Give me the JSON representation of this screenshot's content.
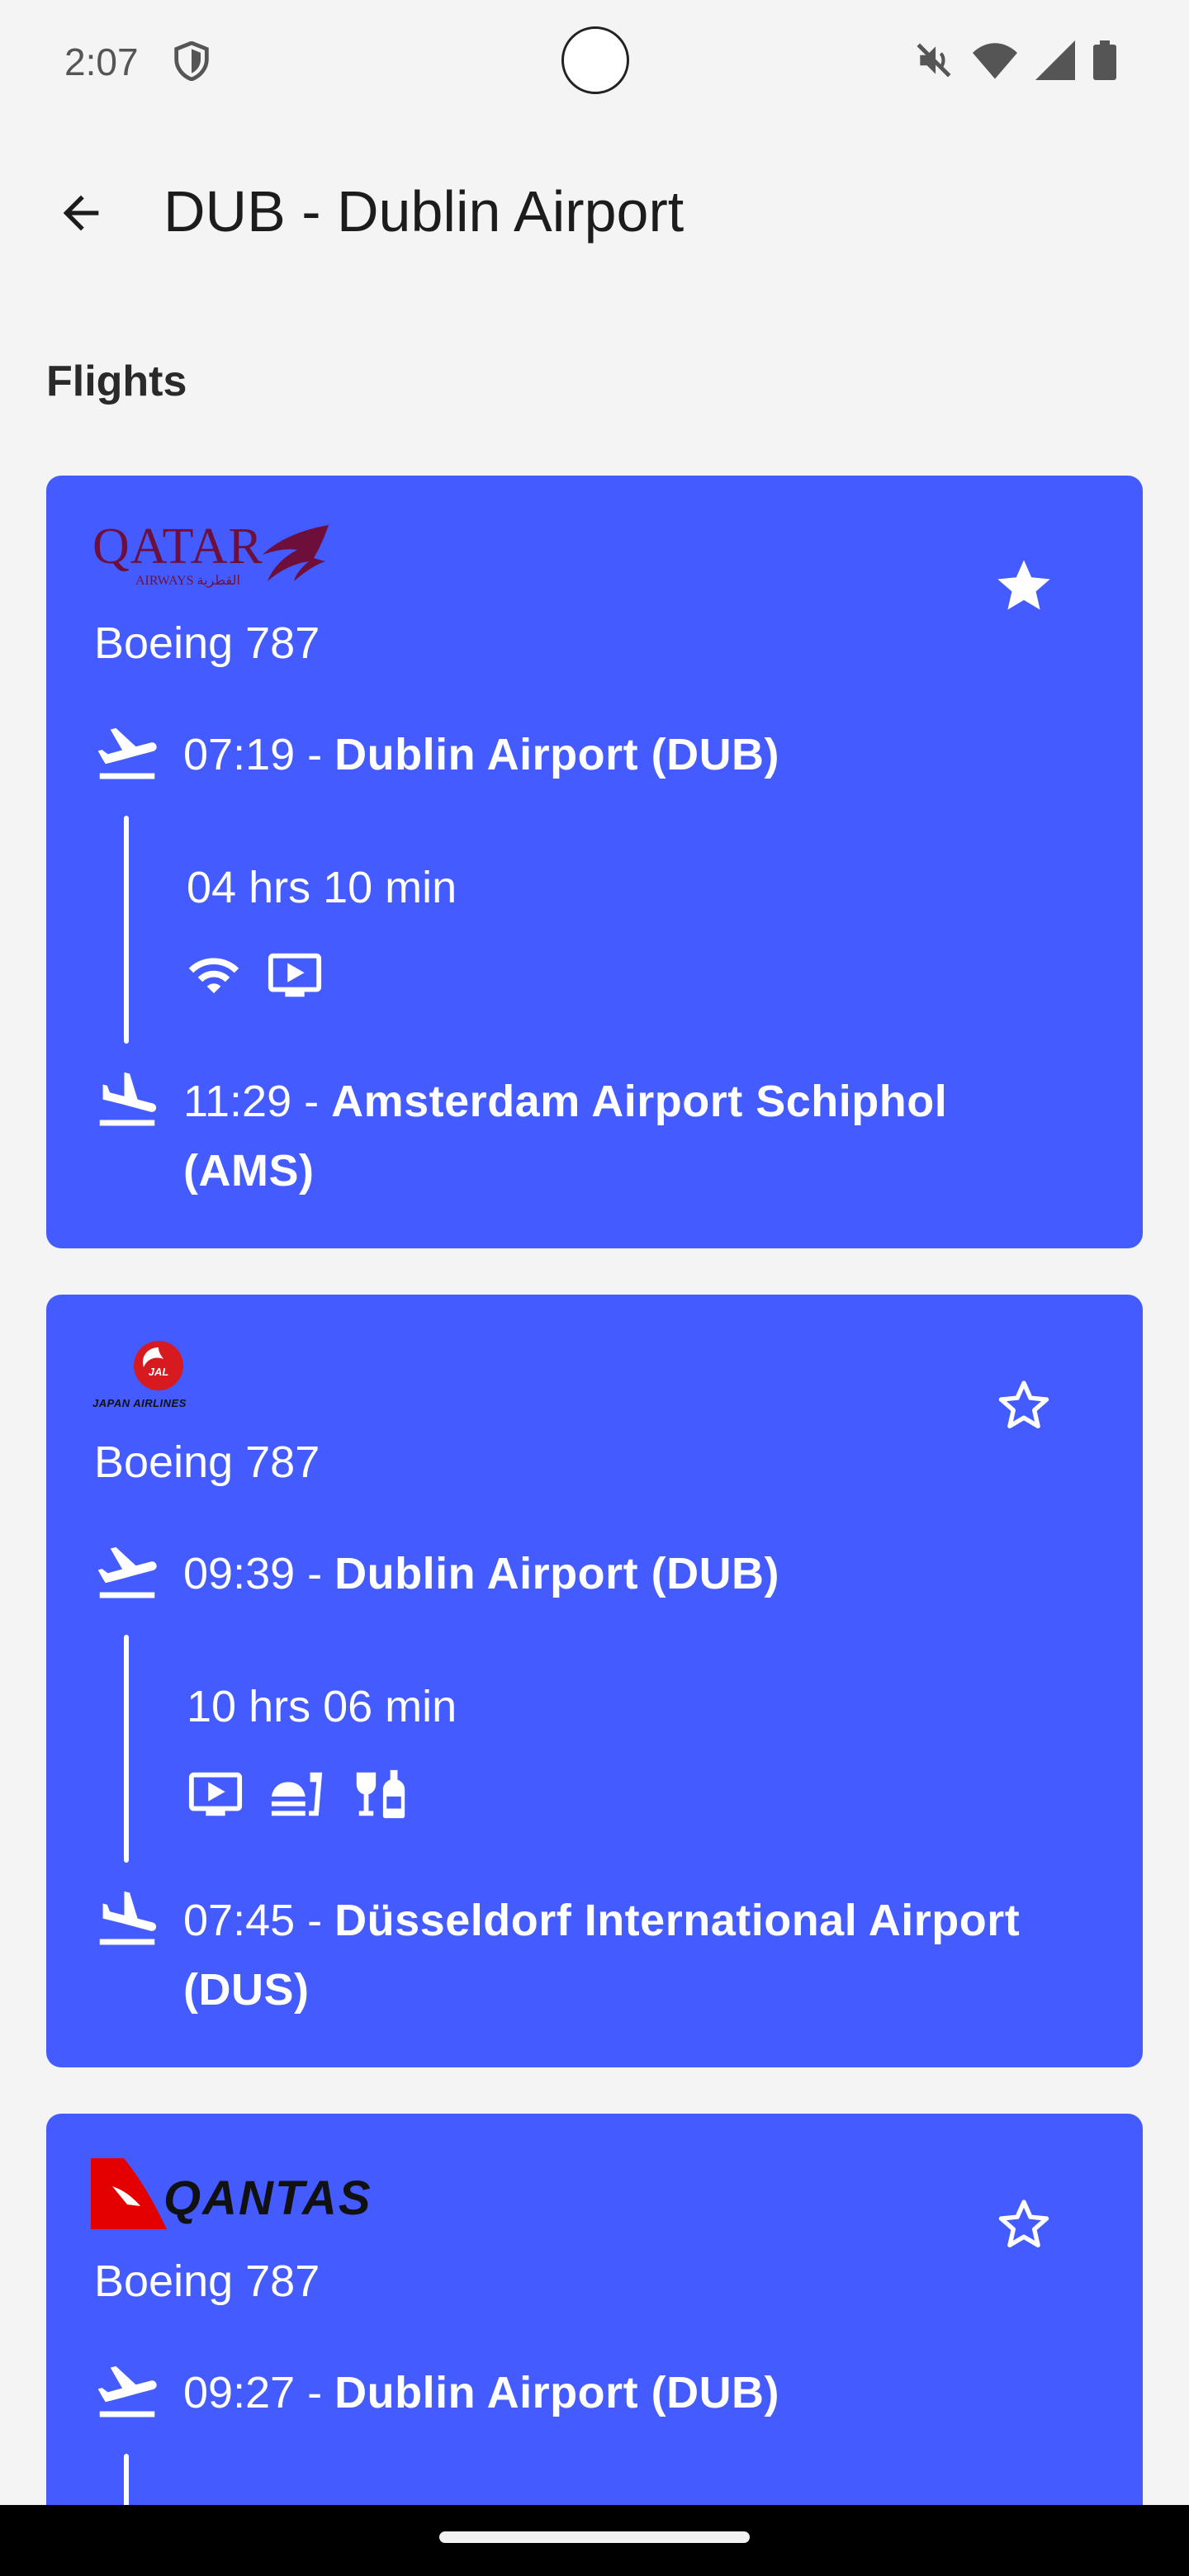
{
  "status_bar": {
    "time": "2:07",
    "icons": [
      "shield-icon",
      "mute-icon",
      "wifi-icon",
      "signal-icon",
      "battery-icon"
    ]
  },
  "app_bar": {
    "back_icon": "arrow-back-icon",
    "title": "DUB - Dublin Airport"
  },
  "section_title": "Flights",
  "colors": {
    "card_background": "#435bff",
    "page_background": "#f4f4f4",
    "text_on_card": "#ffffff"
  },
  "flights": [
    {
      "airline": "Qatar Airways",
      "logo_text": "QATAR",
      "logo_subtext": "AIRWAYS القطرية",
      "favorite": true,
      "aircraft": "Boeing 787",
      "departure": {
        "time": "07:19",
        "separator": " - ",
        "airport": "Dublin Airport (DUB)"
      },
      "duration": "04 hrs 10 min",
      "amenities": [
        "wifi-icon",
        "tv-icon"
      ],
      "arrival": {
        "time": "11:29",
        "separator": " - ",
        "airport": "Amsterdam Airport Schiphol (AMS)"
      }
    },
    {
      "airline": "Japan Airlines",
      "logo_text": "JAL",
      "logo_subtext": "JAPAN AIRLINES",
      "favorite": false,
      "aircraft": "Boeing 787",
      "departure": {
        "time": "09:39",
        "separator": " - ",
        "airport": "Dublin Airport (DUB)"
      },
      "duration": "10 hrs 06 min",
      "amenities": [
        "tv-icon",
        "meal-icon",
        "drinks-icon"
      ],
      "arrival": {
        "time": "07:45",
        "separator": " - ",
        "airport": "Düsseldorf International Airport (DUS)"
      }
    },
    {
      "airline": "Qantas",
      "logo_text": "QANTAS",
      "favorite": false,
      "aircraft": "Boeing 787",
      "departure": {
        "time": "09:27",
        "separator": " - ",
        "airport": "Dublin Airport (DUB)"
      }
    }
  ]
}
